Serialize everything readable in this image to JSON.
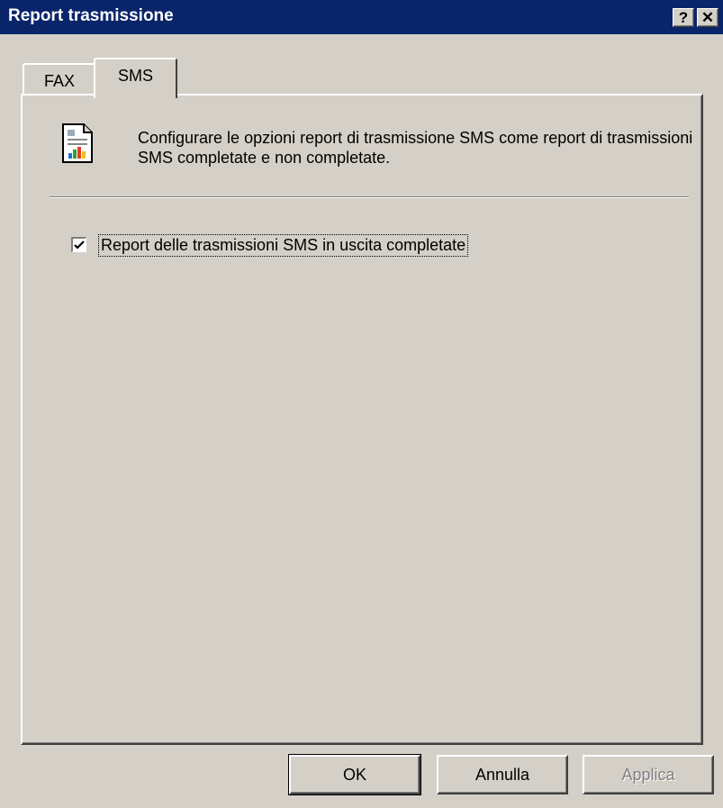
{
  "window": {
    "title": "Report trasmissione",
    "help_label": "?",
    "close_label": "✕"
  },
  "tabs": [
    {
      "label": "FAX",
      "selected": false
    },
    {
      "label": "SMS",
      "selected": true
    }
  ],
  "sms_panel": {
    "icon": "document-chart-icon",
    "description": "Configurare le opzioni report di trasmissione SMS come report di trasmissioni SMS completate e non completate.",
    "checkbox": {
      "label": "Report delle trasmissioni SMS in uscita completate",
      "checked": true
    }
  },
  "buttons": {
    "ok": "OK",
    "cancel": "Annulla",
    "apply": "Applica",
    "apply_enabled": false
  },
  "colors": {
    "titlebar": "#0a246a",
    "face": "#d4d0c8"
  }
}
